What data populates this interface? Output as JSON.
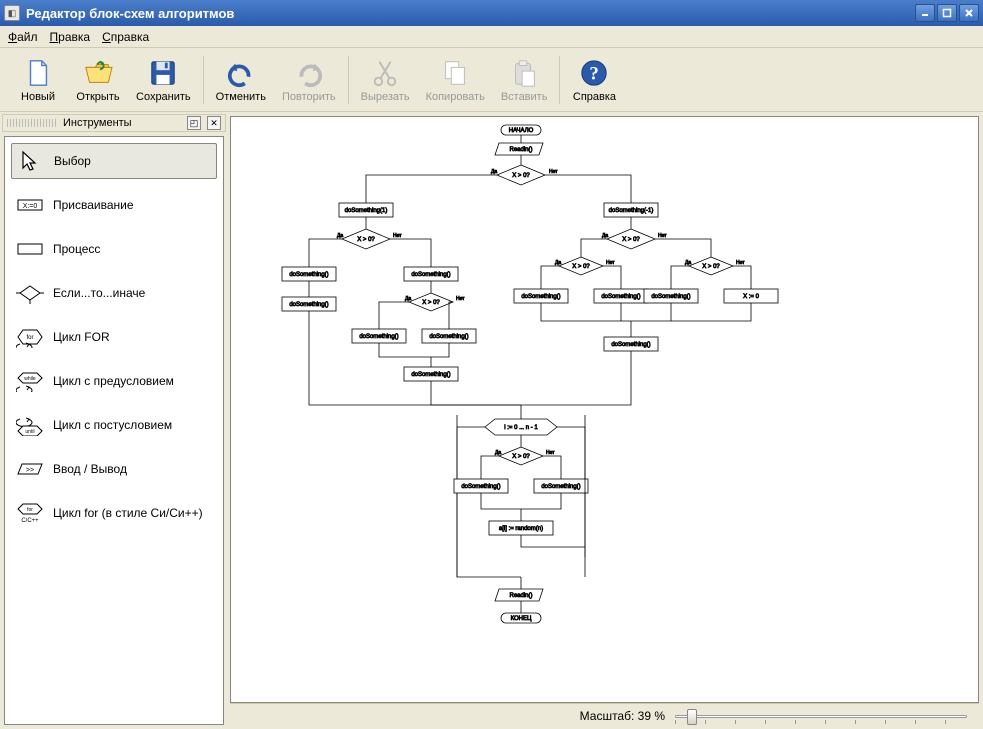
{
  "window": {
    "title": "Редактор блок-схем алгоритмов"
  },
  "menu": {
    "file": "Файл",
    "edit": "Правка",
    "help": "Справка"
  },
  "toolbar": {
    "new": "Новый",
    "open": "Открыть",
    "save": "Сохранить",
    "undo": "Отменить",
    "redo": "Повторить",
    "cut": "Вырезать",
    "copy": "Копировать",
    "paste": "Вставить",
    "help": "Справка"
  },
  "instruments": {
    "title": "Инструменты",
    "select": "Выбор",
    "assign": "Присваивание",
    "process": "Процесс",
    "if": "Если...то...иначе",
    "for": "Цикл FOR",
    "while": "Цикл с предусловием",
    "until": "Цикл с постусловием",
    "io": "Ввод / Вывод",
    "cfor": "Цикл for (в стиле Си/Си++)"
  },
  "status": {
    "zoom_label": "Масштаб: 39 %",
    "zoom_value": 39
  },
  "flowchart": {
    "begin": "НАЧАЛО",
    "end": "КОНЕЦ",
    "readln": "Readln()",
    "cond": "X > 0?",
    "yes": "Да",
    "no": "Нет",
    "do1": "doSomething(-1)",
    "do1p": "doSomething(1)",
    "do": "doSomething()",
    "xassign": "X := 0",
    "forhead": "i := 0 ... n - 1",
    "rand": "a[i] := random(n)"
  }
}
